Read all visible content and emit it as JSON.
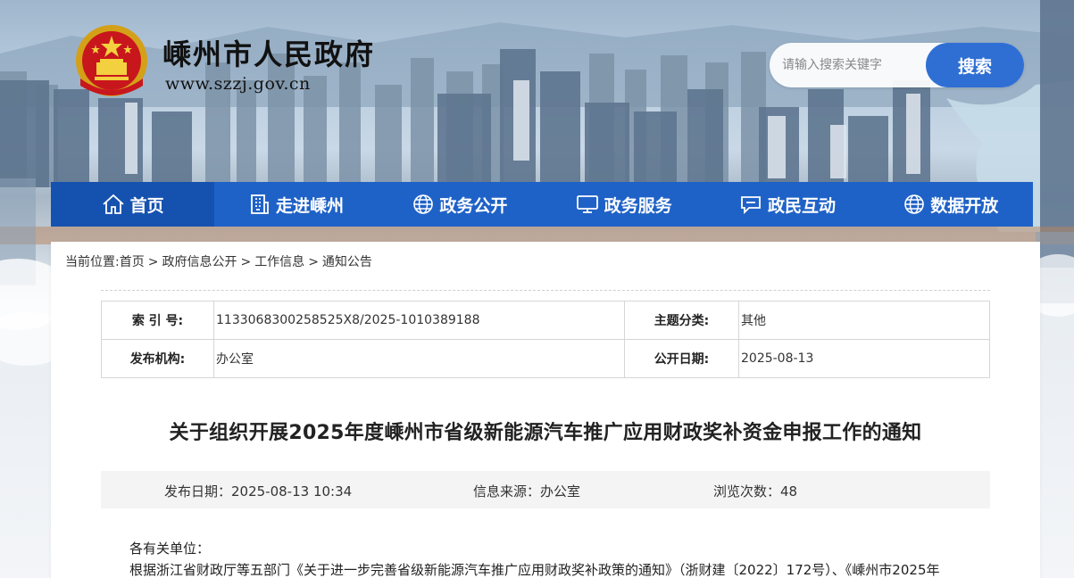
{
  "site": {
    "title": "嵊州市人民政府",
    "url": "www.szzj.gov.cn",
    "emblem_icon": "national-emblem-icon"
  },
  "search": {
    "placeholder": "请输入搜索关键字",
    "button_label": "搜索"
  },
  "colors": {
    "nav_bg": "#1f62c7",
    "nav_active": "#1552b0",
    "search_button": "#2f6fd4"
  },
  "nav": {
    "items": [
      {
        "label": "首页",
        "icon": "home-icon"
      },
      {
        "label": "走进嵊州",
        "icon": "building-icon"
      },
      {
        "label": "政务公开",
        "icon": "globe-icon"
      },
      {
        "label": "政务服务",
        "icon": "monitor-icon"
      },
      {
        "label": "政民互动",
        "icon": "chat-icon"
      },
      {
        "label": "数据开放",
        "icon": "globe-icon"
      }
    ],
    "active_index": 0
  },
  "breadcrumb": {
    "prefix": "当前位置:",
    "items": [
      "首页",
      "政府信息公开",
      "工作信息",
      "通知公告"
    ],
    "separator": ">"
  },
  "meta": {
    "index_label": "索 引 号:",
    "index_value": "1133068300258525X8/2025-1010389188",
    "topic_label": "主题分类:",
    "topic_value": "其他",
    "publisher_label": "发布机构:",
    "publisher_value": "办公室",
    "public_date_label": "公开日期:",
    "public_date_value": "2025-08-13"
  },
  "article": {
    "title": "关于组织开展2025年度嵊州市省级新能源汽车推广应用财政奖补资金申报工作的通知",
    "publish_date": "发布日期：2025-08-13 10:34",
    "source": "信息来源：办公室",
    "views": "浏览次数：48",
    "greeting": "各有关单位：",
    "first_line": "根据浙江省财政厅等五部门《关于进一步完善省级新能源汽车推广应用财政奖补政策的通知》（浙财建〔2022〕172号）、《嵊州市2025年"
  }
}
